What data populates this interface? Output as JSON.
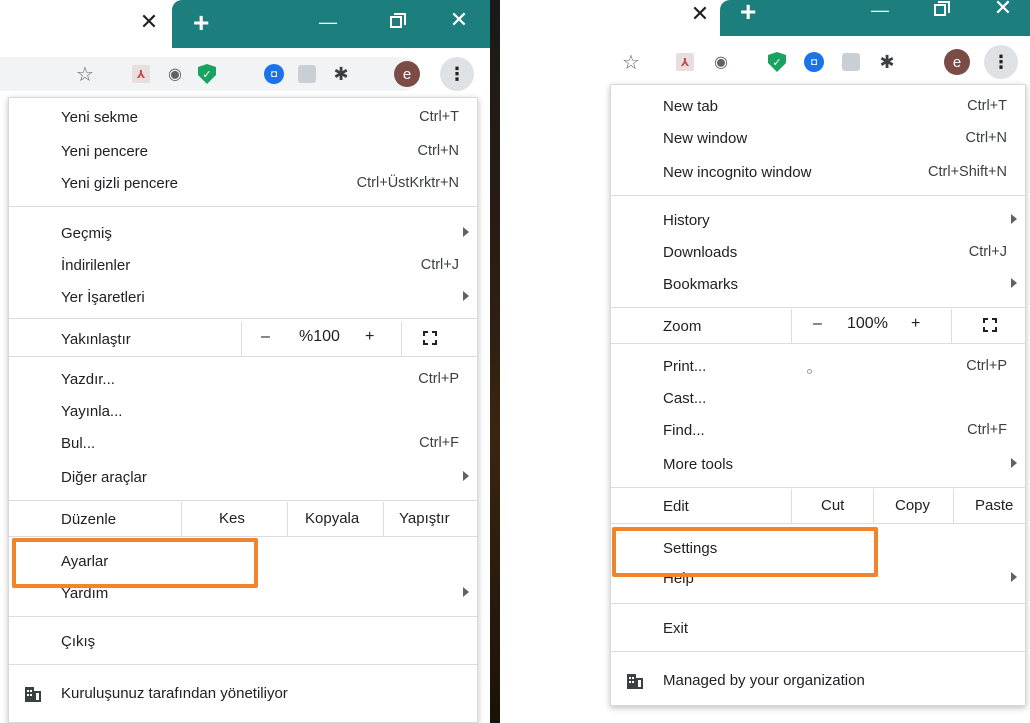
{
  "left": {
    "tab_close": "✕",
    "new_tab": "+",
    "menu": {
      "new_tab": {
        "label": "Yeni sekme",
        "shortcut": "Ctrl+T"
      },
      "new_window": {
        "label": "Yeni pencere",
        "shortcut": "Ctrl+N"
      },
      "new_incognito": {
        "label": "Yeni gizli pencere",
        "shortcut": "Ctrl+ÜstKrktr+N"
      },
      "history": {
        "label": "Geçmiş"
      },
      "downloads": {
        "label": "İndirilenler",
        "shortcut": "Ctrl+J"
      },
      "bookmarks": {
        "label": "Yer İşaretleri"
      },
      "zoom": {
        "label": "Yakınlaştır",
        "minus": "–",
        "value": "%100",
        "plus": "+"
      },
      "print": {
        "label": "Yazdır...",
        "shortcut": "Ctrl+P"
      },
      "cast": {
        "label": "Yayınla..."
      },
      "find": {
        "label": "Bul...",
        "shortcut": "Ctrl+F"
      },
      "more_tools": {
        "label": "Diğer araçlar"
      },
      "edit": {
        "label": "Düzenle",
        "cut": "Kes",
        "copy": "Kopyala",
        "paste": "Yapıştır"
      },
      "settings": {
        "label": "Ayarlar"
      },
      "help": {
        "label": "Yardım"
      },
      "exit": {
        "label": "Çıkış"
      },
      "managed": {
        "label": "Kuruluşunuz tarafından yönetiliyor"
      }
    }
  },
  "right": {
    "tab_close": "✕",
    "new_tab": "+",
    "menu": {
      "new_tab": {
        "label": "New tab",
        "shortcut": "Ctrl+T"
      },
      "new_window": {
        "label": "New window",
        "shortcut": "Ctrl+N"
      },
      "new_incognito": {
        "label": "New incognito window",
        "shortcut": "Ctrl+Shift+N"
      },
      "history": {
        "label": "History"
      },
      "downloads": {
        "label": "Downloads",
        "shortcut": "Ctrl+J"
      },
      "bookmarks": {
        "label": "Bookmarks"
      },
      "zoom": {
        "label": "Zoom",
        "minus": "–",
        "value": "100%",
        "plus": "+"
      },
      "print": {
        "label": "Print...",
        "shortcut": "Ctrl+P"
      },
      "cast": {
        "label": "Cast..."
      },
      "find": {
        "label": "Find...",
        "shortcut": "Ctrl+F"
      },
      "more_tools": {
        "label": "More tools"
      },
      "edit": {
        "label": "Edit",
        "cut": "Cut",
        "copy": "Copy",
        "paste": "Paste"
      },
      "settings": {
        "label": "Settings"
      },
      "help": {
        "label": "Help"
      },
      "exit": {
        "label": "Exit"
      },
      "managed": {
        "label": "Managed by your organization"
      }
    }
  },
  "toolbar": {
    "star": "☆",
    "pdf": "⅄",
    "shield": "◉",
    "green_shield": "✓",
    "blue_circle": "◘",
    "puzzle": "✱",
    "avatar": "e",
    "kebab": "⋮"
  },
  "window": {
    "minimize": "—",
    "close": "✕"
  },
  "colors": {
    "accent_teal": "#1d7e7e",
    "highlight": "#f0852d",
    "toolbar_bg": "#f1f3f4"
  }
}
